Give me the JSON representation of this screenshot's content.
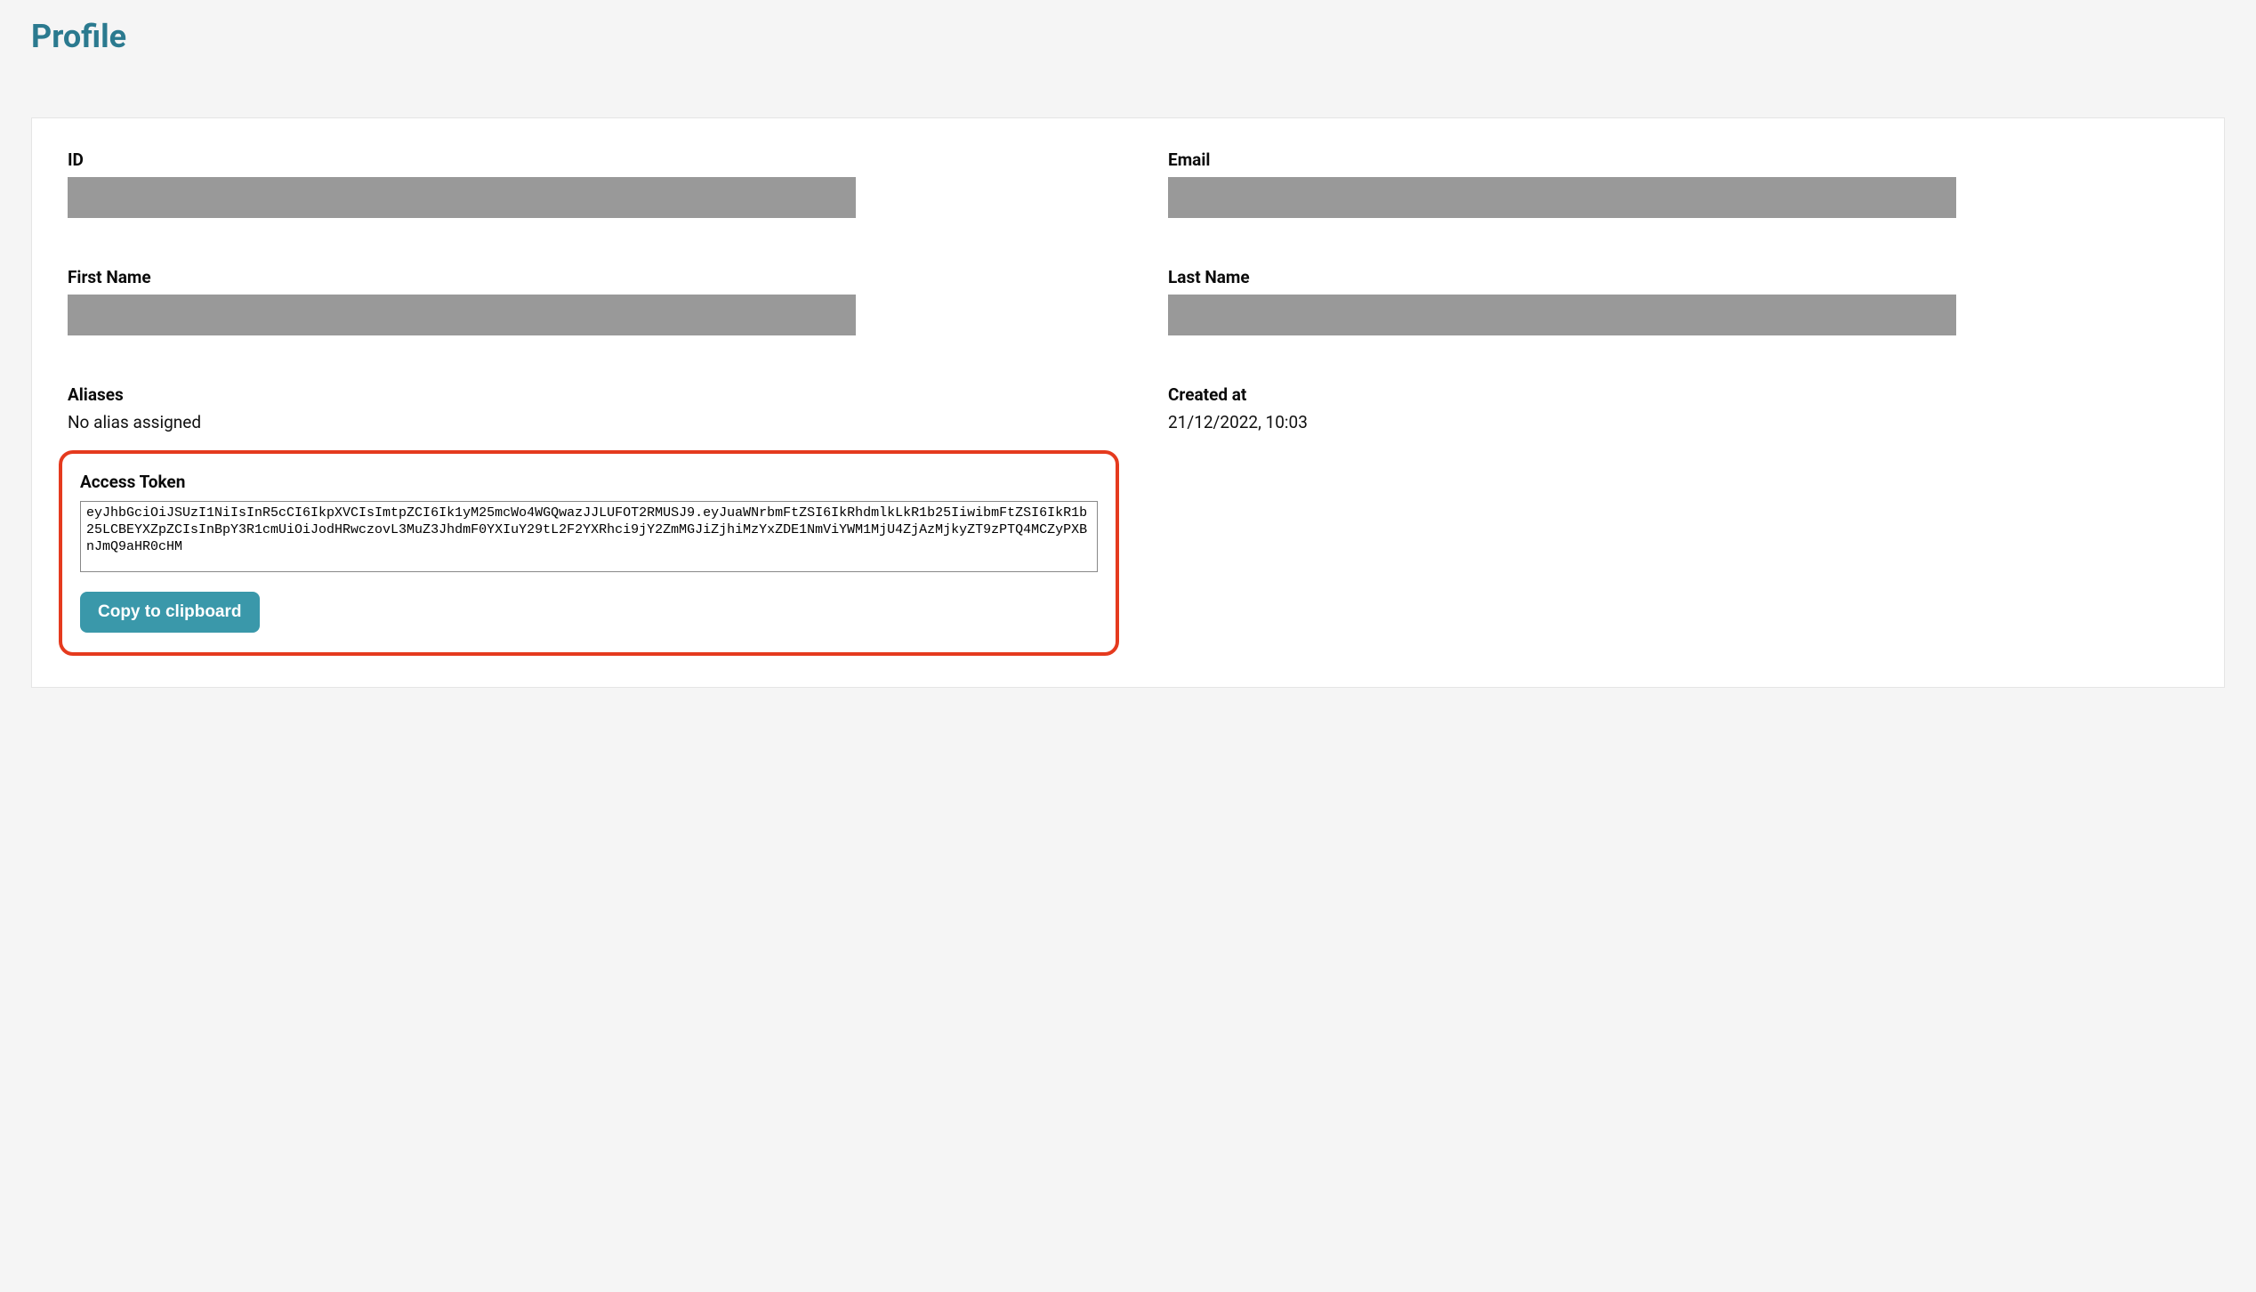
{
  "page": {
    "title": "Profile"
  },
  "profile": {
    "id": {
      "label": "ID",
      "value": ""
    },
    "email": {
      "label": "Email",
      "value": ""
    },
    "first_name": {
      "label": "First Name",
      "value": ""
    },
    "last_name": {
      "label": "Last Name",
      "value": ""
    },
    "aliases": {
      "label": "Aliases",
      "value": "No alias assigned"
    },
    "created_at": {
      "label": "Created at",
      "value": "21/12/2022, 10:03"
    },
    "access_token": {
      "label": "Access Token",
      "value": "eyJhbGciOiJSUzI1NiIsInR5cCI6IkpXVCIsImtpZCI6Ik1yM25mcWo4WGQwazJJLUFOT2RMUSJ9.eyJuaWNrbmFtZSI6IkRhdmlkLkR1b25IiwibmFtZSI6IkR1b25LCBEYXZpZCIsInBpY3R1cmUiOiJodHRwczovL3MuZ3JhdmF0YXIuY29tL2F2YXRhci9jY2ZmMGJiZjhiMzYxZDE1NmViYWM1MjU4ZjAzMjkyZT9zPTQ4MCZyPXBnJmQ9aHR0cHM"
    },
    "copy_button_label": "Copy to clipboard"
  }
}
